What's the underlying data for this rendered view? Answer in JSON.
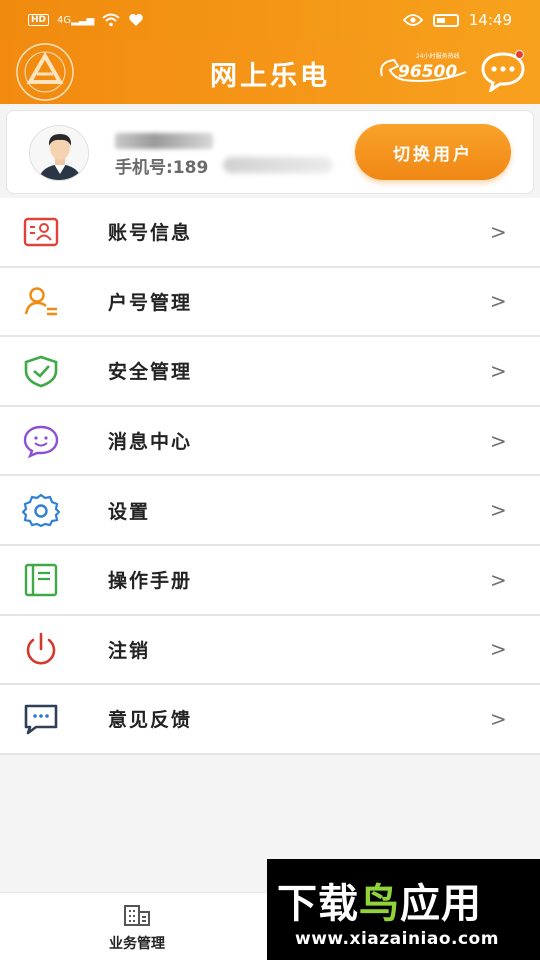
{
  "status_bar": {
    "network_label": "HD",
    "signal_label": "4G",
    "time": "14:49"
  },
  "header": {
    "title": "网上乐电",
    "hotline_number": "96500",
    "hotline_caption": "24小时服务热线",
    "logo_icon": "state-grid-logo-icon",
    "chat_icon": "chat-bubble-icon"
  },
  "user_card": {
    "phone_label": "手机号:189",
    "switch_button": "切换用户"
  },
  "menu": {
    "items": [
      {
        "label": "账号信息",
        "icon": "id-card-icon",
        "color": "#e0423a"
      },
      {
        "label": "户号管理",
        "icon": "user-list-icon",
        "color": "#f08a10"
      },
      {
        "label": "安全管理",
        "icon": "shield-check-icon",
        "color": "#3daa45"
      },
      {
        "label": "消息中心",
        "icon": "message-smile-icon",
        "color": "#8b4fd8"
      },
      {
        "label": "设置",
        "icon": "gear-icon",
        "color": "#2f7fd6"
      },
      {
        "label": "操作手册",
        "icon": "book-icon",
        "color": "#3daa45"
      },
      {
        "label": "注销",
        "icon": "power-icon",
        "color": "#d23a2e"
      },
      {
        "label": "意见反馈",
        "icon": "feedback-icon",
        "color": "#2e3f5a"
      }
    ],
    "chevron": ">"
  },
  "bottom_bar": {
    "tab_business": "业务管理"
  },
  "watermark": {
    "title_part1": "下载",
    "title_part2": "鸟",
    "title_part3": "应用",
    "url": "www.xiazainiao.com"
  }
}
